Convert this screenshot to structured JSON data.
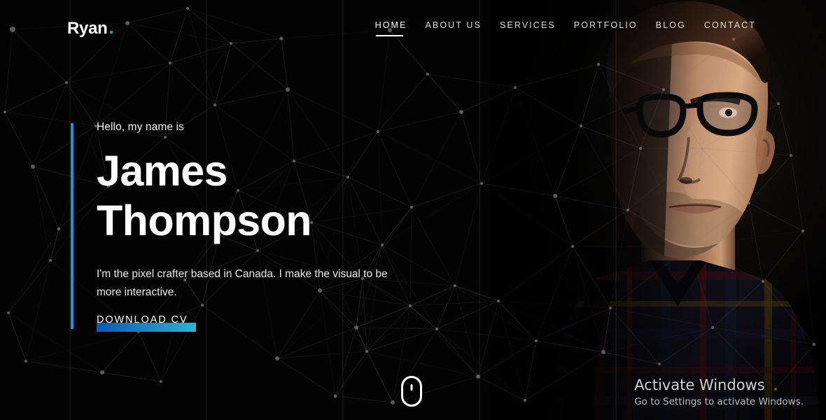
{
  "header": {
    "logo_text": "Ryan",
    "logo_dot": ".",
    "nav": [
      {
        "label": "HOME",
        "active": true
      },
      {
        "label": "ABOUT US",
        "active": false
      },
      {
        "label": "SERVICES",
        "active": false
      },
      {
        "label": "PORTFOLIO",
        "active": false
      },
      {
        "label": "BLOG",
        "active": false
      },
      {
        "label": "CONTACT",
        "active": false
      }
    ]
  },
  "hero": {
    "greeting": "Hello, my name is",
    "name_line1": "James",
    "name_line2": "Thompson",
    "description": "I'm the pixel crafter based in Canada. I make the visual to be more interactive.",
    "cta_label": "DOWNLOAD CV",
    "accent_color": "#1e8fe8",
    "cta_gradient_from": "#0d57b5",
    "cta_gradient_to": "#2bb3cf"
  },
  "scroll_indicator": {
    "icon": "mouse-scroll-icon"
  },
  "watermark": {
    "title": "Activate Windows",
    "subtitle": "Go to Settings to activate Windows."
  },
  "background": {
    "type": "particle-network",
    "base_color": "#000000",
    "particle_color": "#8a8a8a",
    "line_color": "#6e6e6e",
    "gridline_color": "#1c1c1c",
    "gridline_positions": [
      100,
      295,
      490,
      685,
      880
    ],
    "particles": [
      [
        18,
        42,
        4
      ],
      [
        182,
        33,
        3
      ],
      [
        268,
        12,
        2
      ],
      [
        330,
        62,
        2
      ],
      [
        402,
        55,
        2.5
      ],
      [
        243,
        90,
        2
      ],
      [
        47,
        238,
        3
      ],
      [
        84,
        327,
        2.5
      ],
      [
        72,
        372,
        2
      ],
      [
        12,
        447,
        2
      ],
      [
        37,
        516,
        2
      ],
      [
        146,
        532,
        3
      ],
      [
        155,
        266,
        2
      ],
      [
        236,
        196,
        2
      ],
      [
        307,
        150,
        2
      ],
      [
        411,
        128,
        3
      ],
      [
        420,
        230,
        2
      ],
      [
        313,
        336,
        2
      ],
      [
        289,
        436,
        2
      ],
      [
        230,
        545,
        2
      ],
      [
        396,
        512,
        3
      ],
      [
        457,
        415,
        3
      ],
      [
        509,
        468,
        3
      ],
      [
        524,
        502,
        2
      ],
      [
        557,
        43,
        3
      ],
      [
        611,
        106,
        2
      ],
      [
        659,
        160,
        3
      ],
      [
        588,
        296,
        2
      ],
      [
        546,
        350,
        2
      ],
      [
        518,
        398,
        2
      ],
      [
        479,
        566,
        2.5
      ],
      [
        561,
        575,
        3
      ],
      [
        683,
        538,
        3
      ],
      [
        750,
        572,
        2
      ],
      [
        688,
        262,
        2
      ],
      [
        736,
        125,
        2
      ],
      [
        793,
        280,
        3
      ],
      [
        818,
        352,
        2
      ],
      [
        855,
        92,
        2
      ],
      [
        872,
        440,
        2
      ],
      [
        897,
        300,
        2
      ],
      [
        948,
        128,
        2
      ],
      [
        1003,
        212,
        2
      ],
      [
        1048,
        56,
        2
      ],
      [
        1112,
        148,
        2
      ],
      [
        1147,
        330,
        2
      ],
      [
        1090,
        402,
        2
      ],
      [
        1018,
        468,
        2
      ],
      [
        942,
        520,
        2
      ],
      [
        862,
        503,
        3
      ],
      [
        1163,
        492,
        2
      ],
      [
        1108,
        556,
        2
      ],
      [
        624,
        470,
        2
      ],
      [
        586,
        437,
        2
      ],
      [
        650,
        408,
        2
      ],
      [
        712,
        430,
        2
      ],
      [
        766,
        487,
        2
      ],
      [
        198,
        474,
        2
      ],
      [
        264,
        400,
        2
      ],
      [
        137,
        180,
        2
      ],
      [
        95,
        118,
        2
      ],
      [
        7,
        160,
        2
      ],
      [
        340,
        272,
        2
      ],
      [
        368,
        358,
        2
      ],
      [
        445,
        318,
        2
      ],
      [
        497,
        253,
        2
      ],
      [
        540,
        188,
        2
      ],
      [
        1130,
        222,
        2
      ],
      [
        1070,
        290,
        2
      ],
      [
        985,
        352,
        2
      ],
      [
        915,
        212,
        2
      ],
      [
        830,
        180,
        2
      ]
    ],
    "link_distance": 168
  }
}
